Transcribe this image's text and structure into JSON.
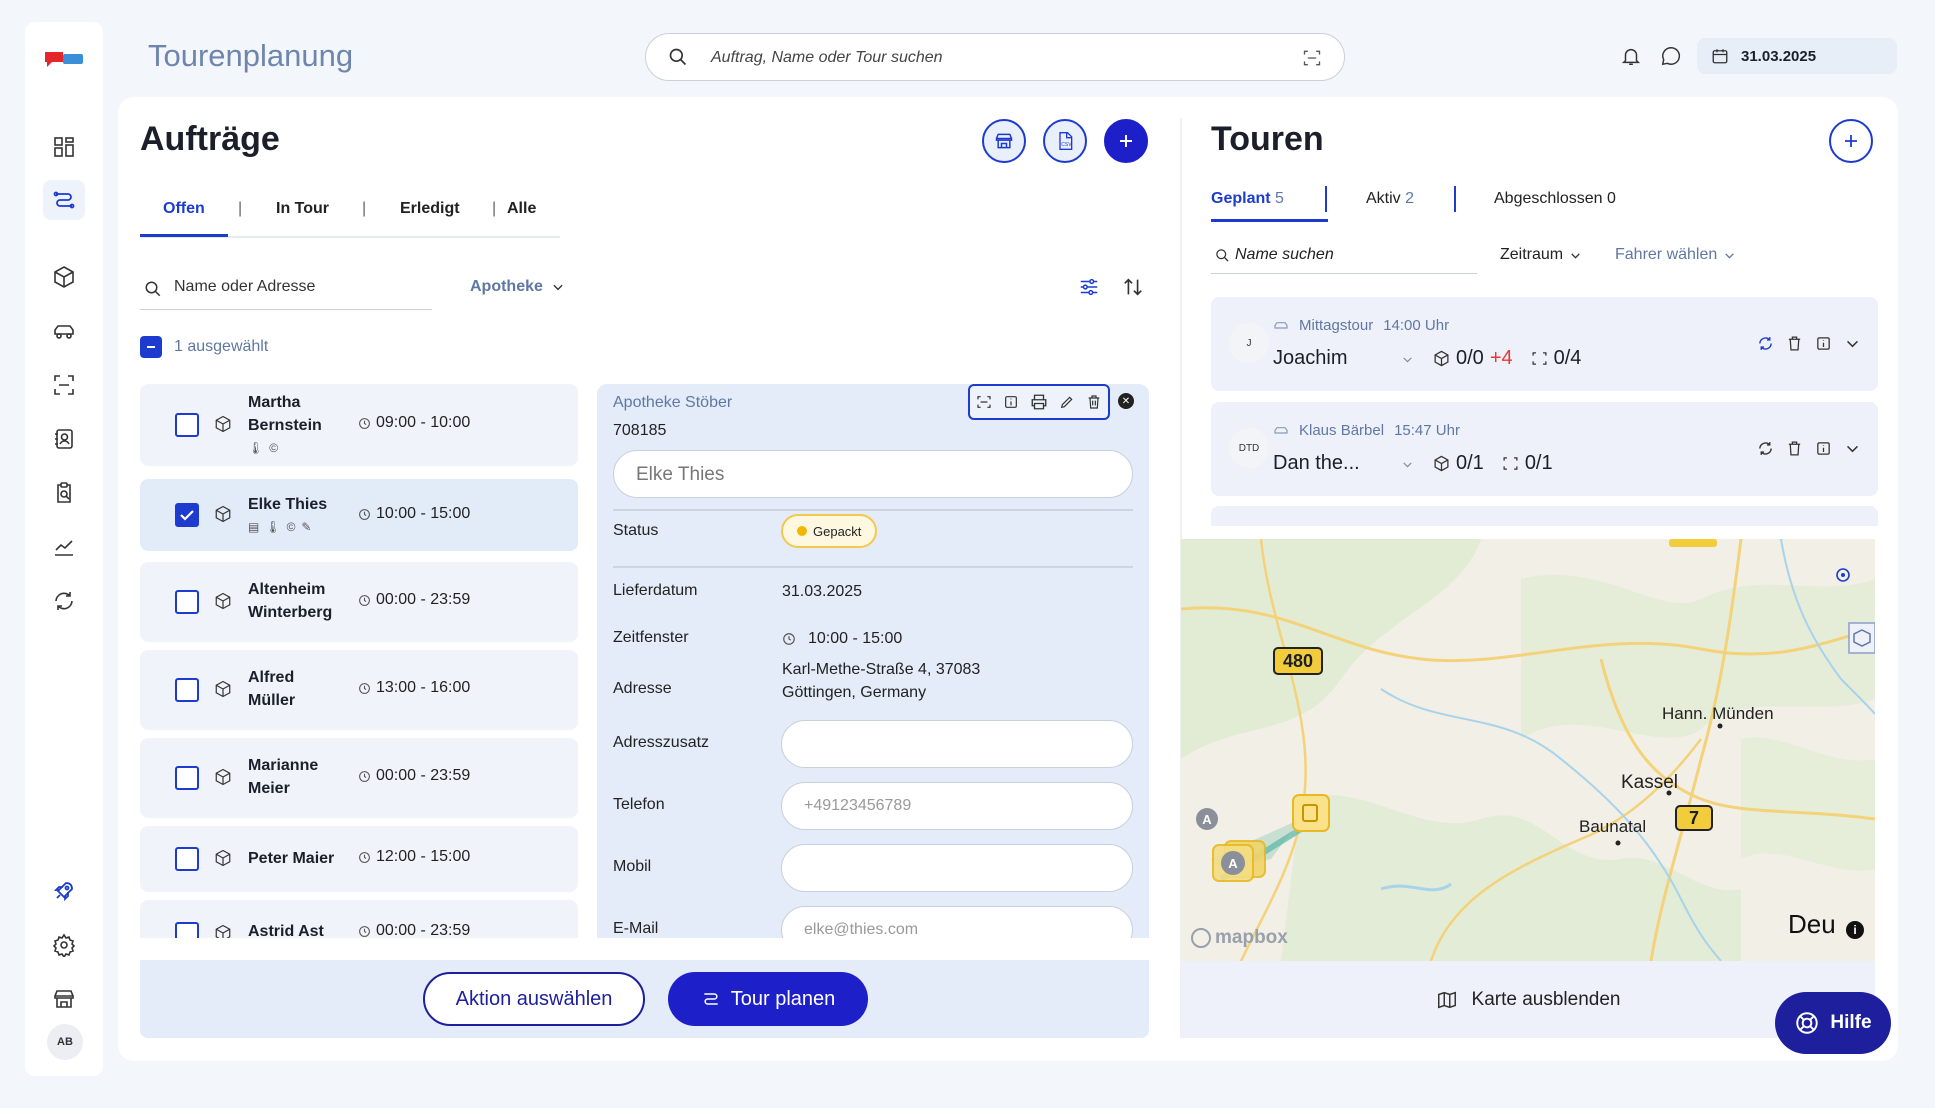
{
  "app": {
    "title": "Tourenplanung"
  },
  "search": {
    "placeholder": "Auftrag, Name oder Tour suchen"
  },
  "header": {
    "date": "31.03.2025"
  },
  "user": {
    "initials": "AB"
  },
  "orders_panel": {
    "title": "Aufträge",
    "tabs": [
      "Offen",
      "In Tour",
      "Erledigt",
      "Alle"
    ],
    "active_tab": "Offen",
    "name_placeholder": "Name oder Adresse",
    "filter": "Apotheke",
    "selected_text": "1 ausgewählt"
  },
  "orders": [
    {
      "name_l1": "Martha",
      "name_l2": "Bernstein",
      "time": "09:00 - 10:00",
      "checked": false,
      "tags": [
        "🌡",
        "©"
      ]
    },
    {
      "name_l1": "Elke Thies",
      "name_l2": "",
      "time": "10:00 - 15:00",
      "checked": true,
      "tags": [
        "▤",
        "🌡",
        "©",
        "✎"
      ]
    },
    {
      "name_l1": "Altenheim",
      "name_l2": "Winterberg",
      "time": "00:00 - 23:59",
      "checked": false,
      "tags": []
    },
    {
      "name_l1": "Alfred",
      "name_l2": "Müller",
      "time": "13:00 - 16:00",
      "checked": false,
      "tags": []
    },
    {
      "name_l1": "Marianne",
      "name_l2": "Meier",
      "time": "00:00 - 23:59",
      "checked": false,
      "tags": []
    },
    {
      "name_l1": "Peter Maier",
      "name_l2": "",
      "time": "12:00 - 15:00",
      "checked": false,
      "tags": []
    },
    {
      "name_l1": "Astrid Ast",
      "name_l2": "",
      "time": "00:00 - 23:59",
      "checked": false,
      "tags": []
    }
  ],
  "detail": {
    "pharmacy": "Apotheke Stöber",
    "number": "708185",
    "customer": "Elke Thies",
    "status_label": "Status",
    "status_value": "Gepackt",
    "date_label": "Lieferdatum",
    "date_value": "31.03.2025",
    "window_label": "Zeitfenster",
    "window_value": "10:00 - 15:00",
    "address_label": "Adresse",
    "address_l1": "Karl-Methe-Straße 4, 37083",
    "address_l2": "Göttingen, Germany",
    "addr_extra_label": "Adresszusatz",
    "phone_label": "Telefon",
    "phone_value": "+49123456789",
    "mobile_label": "Mobil",
    "email_label": "E-Mail",
    "email_value": "elke@thies.com"
  },
  "actions": {
    "choose": "Aktion auswählen",
    "plan": "Tour planen"
  },
  "tours_panel": {
    "title": "Touren",
    "tabs": [
      {
        "label": "Geplant",
        "count": "5"
      },
      {
        "label": "Aktiv",
        "count": "2"
      },
      {
        "label": "Abgeschlossen",
        "count": "0"
      }
    ],
    "search_placeholder": "Name suchen",
    "period": "Zeitraum",
    "driver": "Fahrer wählen"
  },
  "tours": [
    {
      "avatar": "J",
      "name": "Mittagstour",
      "time": "14:00 Uhr",
      "driver": "Joachim",
      "packages": "0/0",
      "extra": "+4",
      "stops": "0/4"
    },
    {
      "avatar": "DTD",
      "name": "Klaus Bärbel",
      "time": "15:47 Uhr",
      "driver": "Dan the...",
      "packages": "0/1",
      "extra": "",
      "stops": "0/1"
    }
  ],
  "map": {
    "labels": [
      "Hann. Münden",
      "Kassel",
      "Baunatal",
      "Deu"
    ],
    "road_badges": [
      "480",
      "7"
    ],
    "attribution": "mapbox",
    "toggle": "Karte ausblenden"
  },
  "help": {
    "label": "Hilfe"
  },
  "colors": {
    "accent": "#1d3ccf",
    "primary_button": "#1d1fc9",
    "help": "#1d1f9c",
    "status_yellow": "#f2b705",
    "red": "#e53935"
  }
}
